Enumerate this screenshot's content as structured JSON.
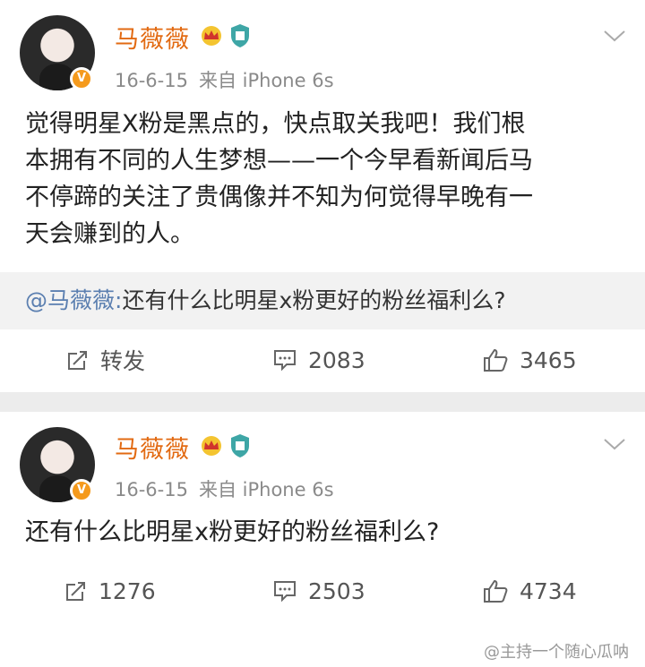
{
  "colors": {
    "name": "#e26a12",
    "mention": "#5b7fb0",
    "meta": "#8a8a8a",
    "background": "#ececec"
  },
  "post1": {
    "user": {
      "name": "马薇薇",
      "verified_badge": "V"
    },
    "meta": {
      "date": "16-6-15",
      "source": "来自 iPhone 6s"
    },
    "lines": [
      "觉得明星X粉是黑点的，快点取关我吧！我们根",
      "本拥有不同的人生梦想——一个今早看新闻后马",
      "不停蹄的关注了贵偶像并不知为何觉得早晚有一",
      "天会赚到的人。"
    ],
    "repost": {
      "mention": "@马薇薇:",
      "text": "还有什么比明星x粉更好的粉丝福利么?"
    },
    "actions": {
      "forward": "转发",
      "comments": "2083",
      "likes": "3465"
    }
  },
  "post2": {
    "user": {
      "name": "马薇薇",
      "verified_badge": "V"
    },
    "meta": {
      "date": "16-6-15",
      "source": "来自 iPhone 6s"
    },
    "text": "还有什么比明星x粉更好的粉丝福利么?",
    "actions": {
      "forward": "1276",
      "comments": "2503",
      "likes": "4734"
    }
  },
  "watermark": "@主持一个随心瓜呐",
  "icons": [
    "crown-icon",
    "shield-icon",
    "chevron-down-icon",
    "forward-icon",
    "comment-icon",
    "like-icon"
  ]
}
